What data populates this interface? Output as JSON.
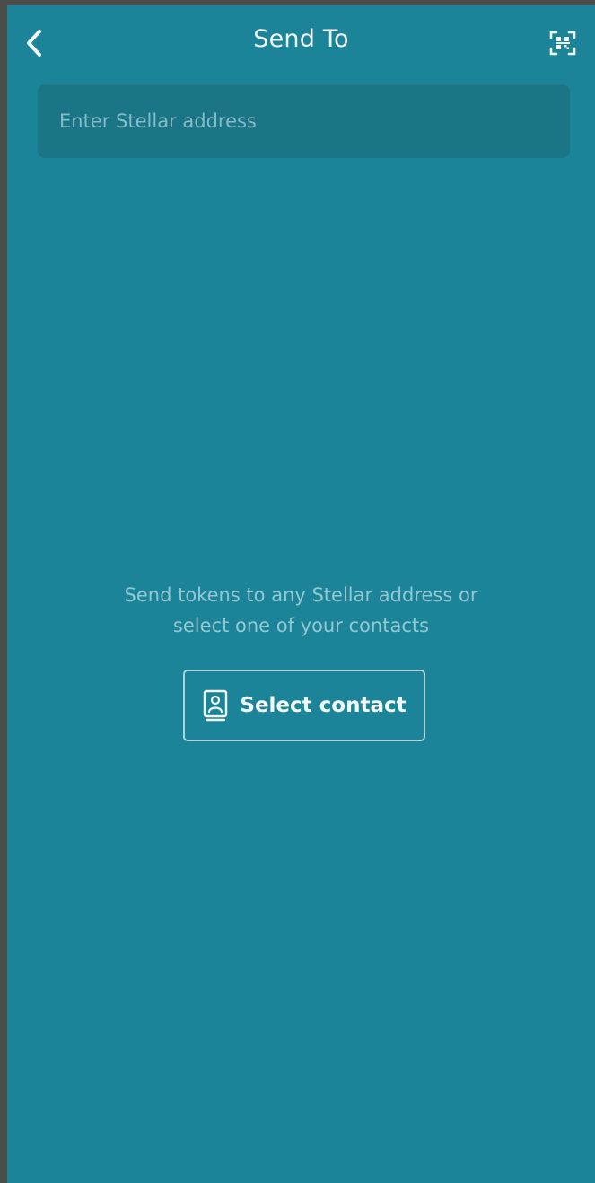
{
  "header": {
    "title": "Send To",
    "back_icon": "chevron-left-icon",
    "scan_icon": "qr-scan-icon"
  },
  "address": {
    "placeholder": "Enter Stellar address",
    "value": ""
  },
  "empty_state": {
    "hint_line1": "Send tokens to any Stellar address or",
    "hint_line2": "select one of your contacts",
    "button_label": "Select contact",
    "button_icon": "contact-card-icon"
  },
  "colors": {
    "background": "#1b8499",
    "input_background": "#1a7587",
    "frame": "#4b4d4a"
  }
}
